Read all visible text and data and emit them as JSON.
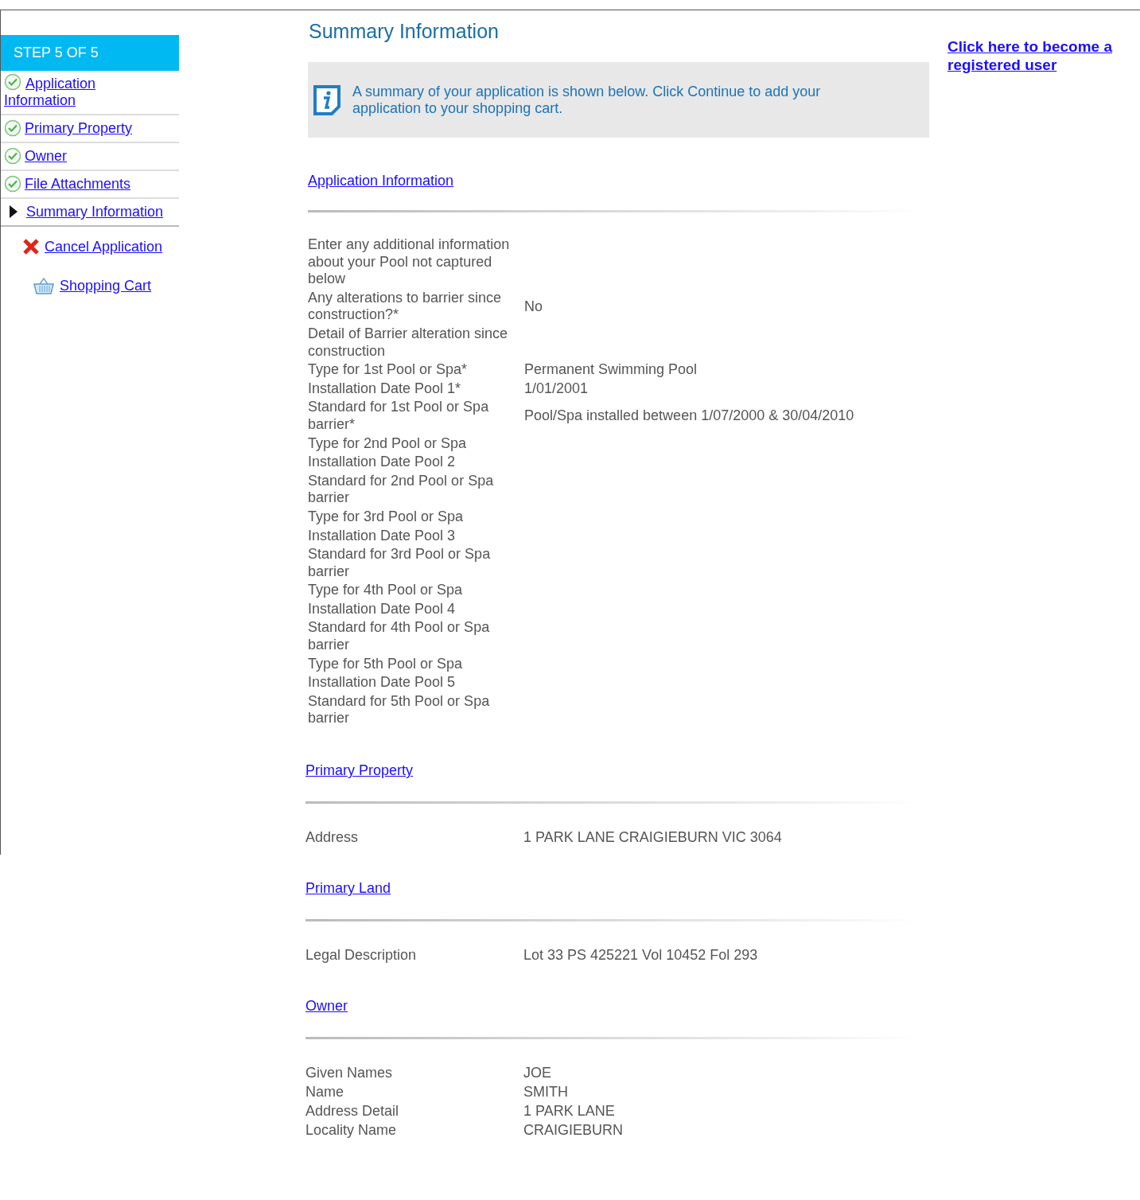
{
  "sidebar": {
    "step": "STEP 5 OF 5",
    "items": [
      {
        "label": "Application Information",
        "done": true
      },
      {
        "label": "Primary Property",
        "done": true
      },
      {
        "label": "Owner",
        "done": true
      },
      {
        "label": "File Attachments",
        "done": true
      },
      {
        "label": "Summary Information",
        "done": false
      }
    ],
    "actions": [
      {
        "label": "Cancel Application",
        "kind": "cancel"
      },
      {
        "label": "Shopping Cart",
        "kind": "cart"
      }
    ]
  },
  "title": "Summary Information",
  "info": "A summary of your application is shown below. Click Continue to add your application to your shopping cart.",
  "register_link": "Click here to become a registered user",
  "sections": [
    {
      "heading": "Application Information",
      "rows": [
        {
          "label": "Enter any additional information about your Pool not captured below"
        },
        {
          "label": "Any alterations to barrier since construction?*",
          "value": "No"
        },
        {
          "label": "Detail of Barrier alteration since construction"
        },
        {
          "label": "Type for 1st Pool or Spa*",
          "value": "Permanent Swimming Pool"
        },
        {
          "label": "Installation Date Pool 1*",
          "value": "1/01/2001"
        },
        {
          "label": "Standard for 1st Pool or Spa barrier*",
          "value": "Pool/Spa installed between 1/07/2000 & 30/04/2010"
        },
        {
          "label": "Type for 2nd Pool or Spa"
        },
        {
          "label": "Installation Date Pool 2"
        },
        {
          "label": "Standard for 2nd Pool or Spa barrier"
        },
        {
          "label": "Type for 3rd Pool or Spa"
        },
        {
          "label": "Installation Date Pool 3"
        },
        {
          "label": "Standard for 3rd Pool or Spa barrier"
        },
        {
          "label": "Type for 4th Pool or Spa"
        },
        {
          "label": "Installation Date Pool 4"
        },
        {
          "label": "Standard for 4th Pool or Spa barrier"
        },
        {
          "label": "Type for 5th Pool or Spa"
        },
        {
          "label": "Installation Date Pool 5"
        },
        {
          "label": "Standard for 5th Pool or Spa barrier"
        }
      ]
    },
    {
      "heading": "Primary Property",
      "rows": [
        {
          "label": "Address",
          "value": "1 PARK LANE CRAIGIEBURN VIC 3064"
        }
      ]
    },
    {
      "heading": "Primary Land",
      "rows": [
        {
          "label": "Legal Description",
          "value": "Lot 33 PS 425221 Vol 10452 Fol 293"
        }
      ]
    },
    {
      "heading": "Owner",
      "rows": [
        {
          "label": "Given Names",
          "value": "JOE"
        },
        {
          "label": "Name",
          "value": "SMITH"
        },
        {
          "label": "Address Detail",
          "value": "1 PARK LANE"
        },
        {
          "label": "Locality Name",
          "value": "CRAIGIEBURN"
        }
      ]
    }
  ]
}
